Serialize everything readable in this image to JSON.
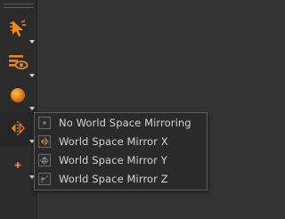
{
  "toolbar": {
    "tools": [
      {
        "name": "select-tool",
        "icon": "select-arrow-icon",
        "has_submenu": true
      },
      {
        "name": "view-options-tool",
        "icon": "eye-layers-icon",
        "has_submenu": true
      },
      {
        "name": "sphere-tool",
        "icon": "sphere-icon",
        "has_submenu": true
      },
      {
        "name": "mirror-tool",
        "icon": "mirror-x-icon",
        "has_submenu": true
      },
      {
        "name": "plus-tool",
        "icon": "plus-icon",
        "has_submenu": true
      }
    ]
  },
  "mirror_menu": {
    "items": [
      {
        "label": "No World Space Mirroring",
        "icon": "no-mirror-icon"
      },
      {
        "label": "World Space Mirror X",
        "icon": "mirror-x-icon"
      },
      {
        "label": "World Space Mirror Y",
        "icon": "mirror-y-icon"
      },
      {
        "label": "World Space Mirror Z",
        "icon": "mirror-z-icon"
      }
    ]
  },
  "colors": {
    "accent": "#f08a1c",
    "toolbar_bg": "#2b2b2b",
    "menu_bg": "#2a2a2a",
    "text": "#d4d4d4"
  }
}
